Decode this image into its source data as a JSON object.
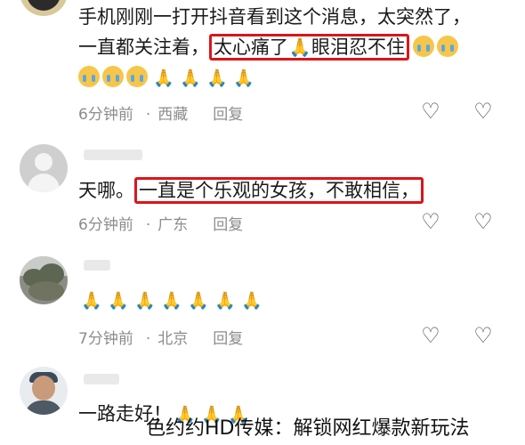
{
  "comments": [
    {
      "lines": [
        "手机刚刚一打开抖音看到这个消息，太突然了，",
        "一直都关注着，"
      ],
      "highlight": "太心痛了",
      "highlight_after": "眼泪忍不住",
      "time": "6分钟前",
      "location": "西藏",
      "reply": "回复"
    },
    {
      "prefix": "天哪。",
      "highlight": "一直是个乐观的女孩，不敢相信，",
      "time": "6分钟前",
      "location": "广东",
      "reply": "回复"
    },
    {
      "time": "7分钟前",
      "location": "北京",
      "reply": "回复"
    },
    {
      "text": "一路走好！"
    }
  ],
  "icons": {
    "like": "heart-icon",
    "dislike": "broken-heart-icon",
    "cry_emoji": "crying-face-emoji",
    "pray_emoji": "folded-hands-emoji"
  },
  "watermark": "色约约HD传媒：解锁网红爆款新玩法",
  "colors": {
    "highlight_border": "#d9161b",
    "meta_text": "#8c8c8c"
  }
}
